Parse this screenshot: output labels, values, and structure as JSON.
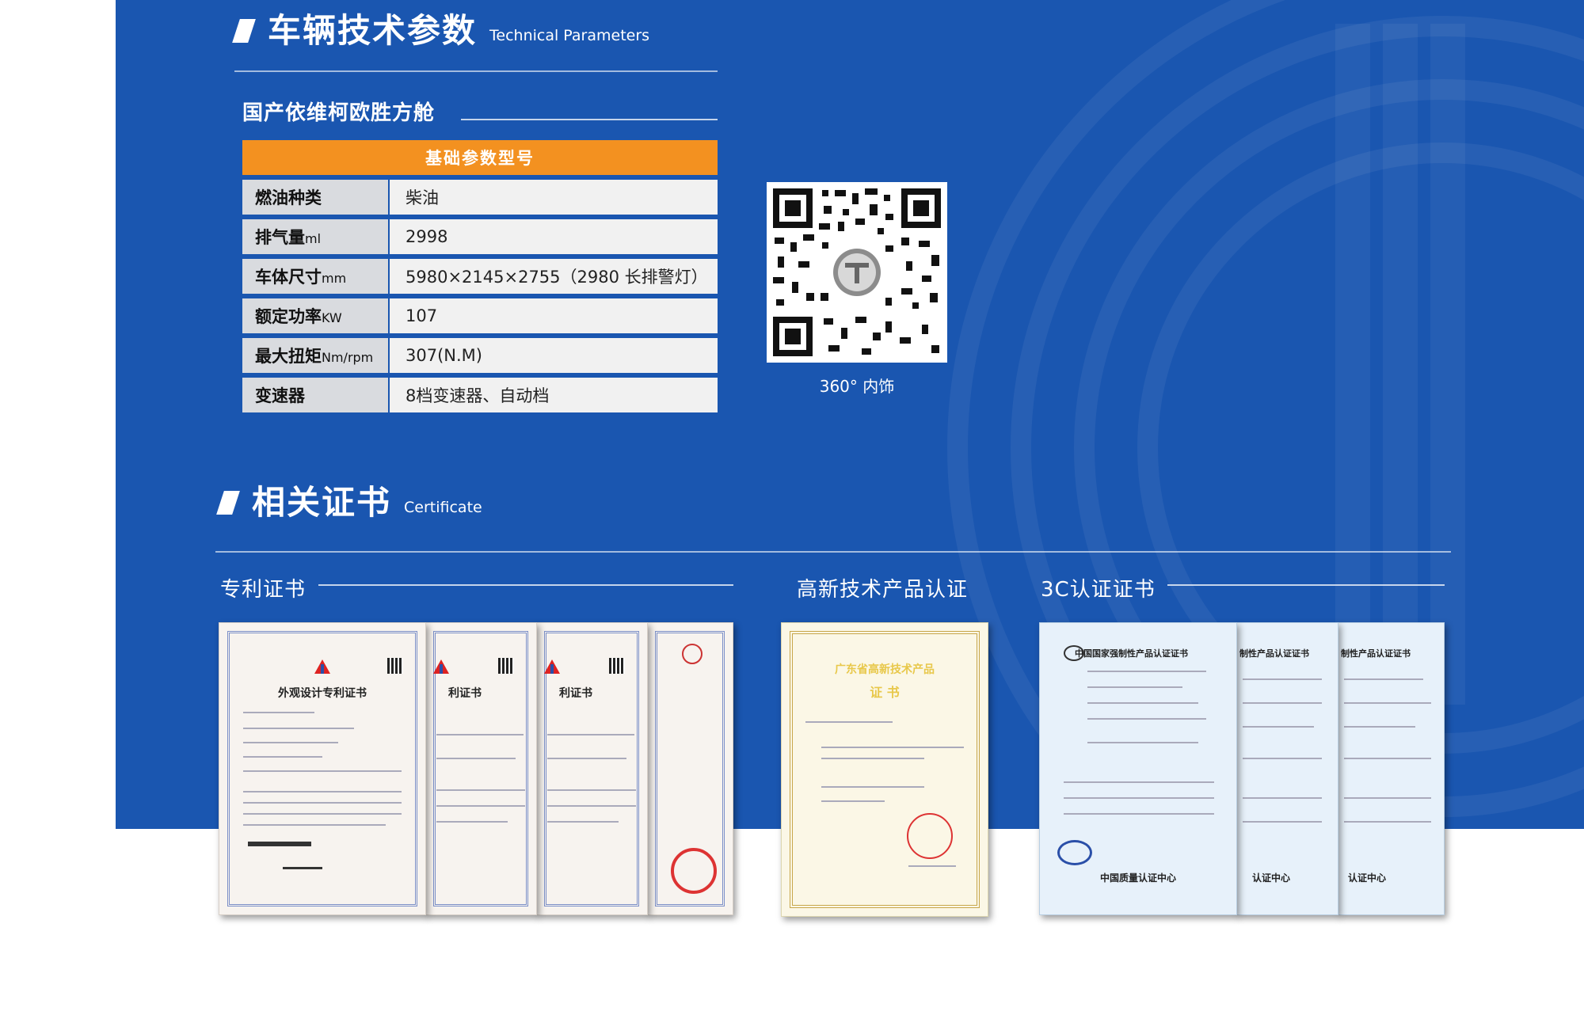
{
  "tech": {
    "title": "车辆技术参数",
    "title_en": "Technical Parameters",
    "subtitle": "国产依维柯欧胜方舱",
    "table_header": "基础参数型号",
    "rows": [
      {
        "label": "燃油种类",
        "unit": "",
        "value": "柴油"
      },
      {
        "label": "排气量",
        "unit": "ml",
        "value": "2998"
      },
      {
        "label": "车体尺寸",
        "unit": "mm",
        "value": "5980×2145×2755（2980 长排警灯）"
      },
      {
        "label": "额定功率",
        "unit": "KW",
        "value": "107"
      },
      {
        "label": "最大扭矩",
        "unit": "Nm/rpm",
        "value": "307(N.M)"
      },
      {
        "label": "变速器",
        "unit": "",
        "value": "8档变速器、自动档"
      }
    ]
  },
  "qr": {
    "caption": "360° 内饰"
  },
  "cert": {
    "title": "相关证书",
    "title_en": "Certificate",
    "groups": [
      {
        "label": "专利证书"
      },
      {
        "label": "高新技术产品认证"
      },
      {
        "label": "3C认证证书"
      }
    ],
    "patent": {
      "doc_title": "外观设计专利证书",
      "doc_title_partial": "利证书"
    },
    "hitech": {
      "doc_title": "广东省高新技术产品",
      "doc_subtitle": "证 书"
    },
    "ccc": {
      "doc_title": "中国国家强制性产品认证证书",
      "doc_title_partial": "制性产品认证证书",
      "doc_footer": "中国质量认证中心",
      "doc_footer_partial": "认证中心"
    }
  },
  "colors": {
    "panel_blue": "#1a56b0",
    "header_orange": "#f39120"
  }
}
